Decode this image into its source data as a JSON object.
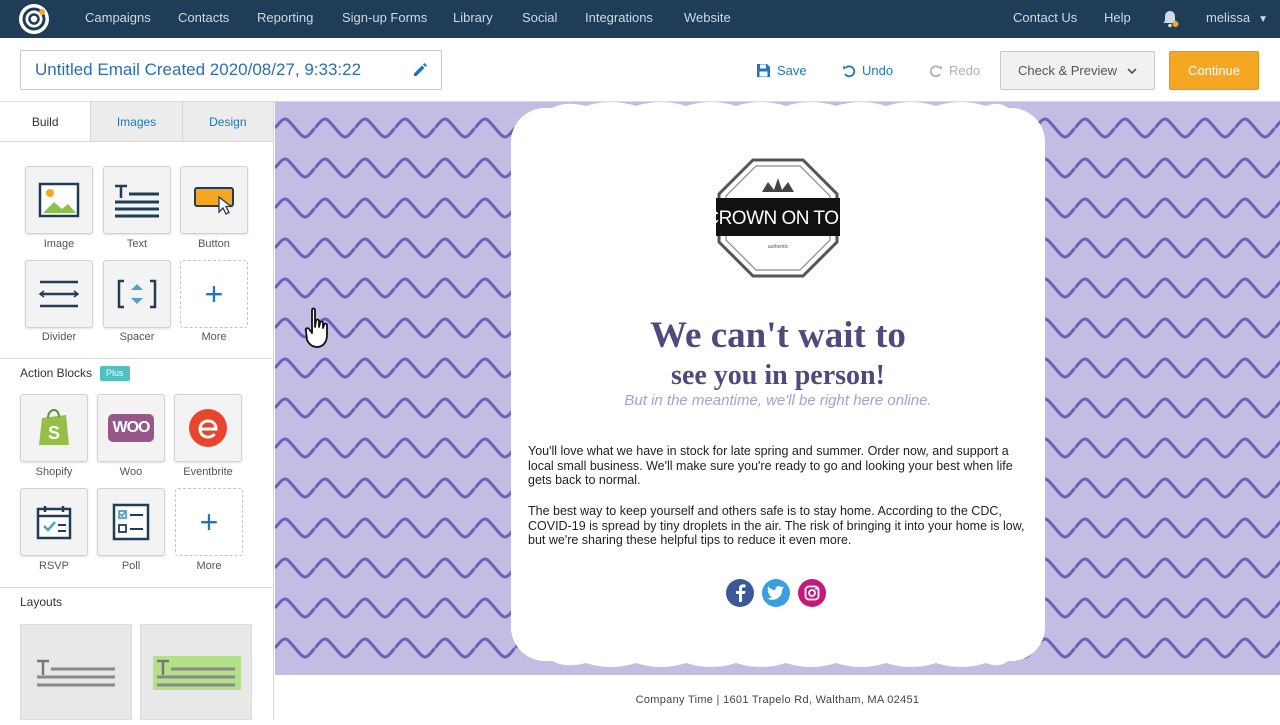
{
  "nav": {
    "items": [
      "Campaigns",
      "Contacts",
      "Reporting",
      "Sign-up Forms",
      "Library",
      "Social",
      "Integrations",
      "Website"
    ],
    "right": {
      "contact": "Contact Us",
      "help": "Help",
      "user": "melissa"
    }
  },
  "toolbar": {
    "title": "Untitled Email Created 2020/08/27, 9:33:22",
    "save": "Save",
    "undo": "Undo",
    "redo": "Redo",
    "check_preview": "Check & Preview",
    "continue": "Continue"
  },
  "sidebar": {
    "tabs": [
      "Build",
      "Images",
      "Design"
    ],
    "build_blocks": [
      "Image",
      "Text",
      "Button",
      "Divider",
      "Spacer",
      "More"
    ],
    "action_blocks_title": "Action Blocks",
    "plus_badge": "Plus",
    "action_blocks": [
      "Shopify",
      "Woo",
      "Eventbrite",
      "RSVP",
      "Poll",
      "More"
    ],
    "woo_logo_text": "WOO",
    "layouts_title": "Layouts"
  },
  "email": {
    "logo_text": "CROWN ON TOP",
    "logo_subtext": "authentic",
    "headline_1": "We can't wait to",
    "headline_2": "see you in person!",
    "subline": "But in the meantime, we'll be right here online.",
    "paragraph_1": "You'll love what we have in stock for late spring and summer. Order now, and support a local small business. We'll make sure you're ready to go and looking your best when life gets back to normal.",
    "paragraph_2": "The best way to keep yourself and others safe is to stay home. According to the CDC, COVID-19 is spread by tiny droplets in the air. The risk of bringing it into your home is low, but we're sharing these helpful tips to reduce it even more.",
    "footer": "Company Time | 1601 Trapelo Rd, Waltham, MA 02451"
  },
  "colors": {
    "nav_bg": "#1f3d57",
    "accent_blue": "#1d76c2",
    "continue_orange": "#f5a623",
    "canvas_bg": "#c3bde3",
    "wave": "#6d61b8",
    "headline": "#4e4a7e"
  }
}
